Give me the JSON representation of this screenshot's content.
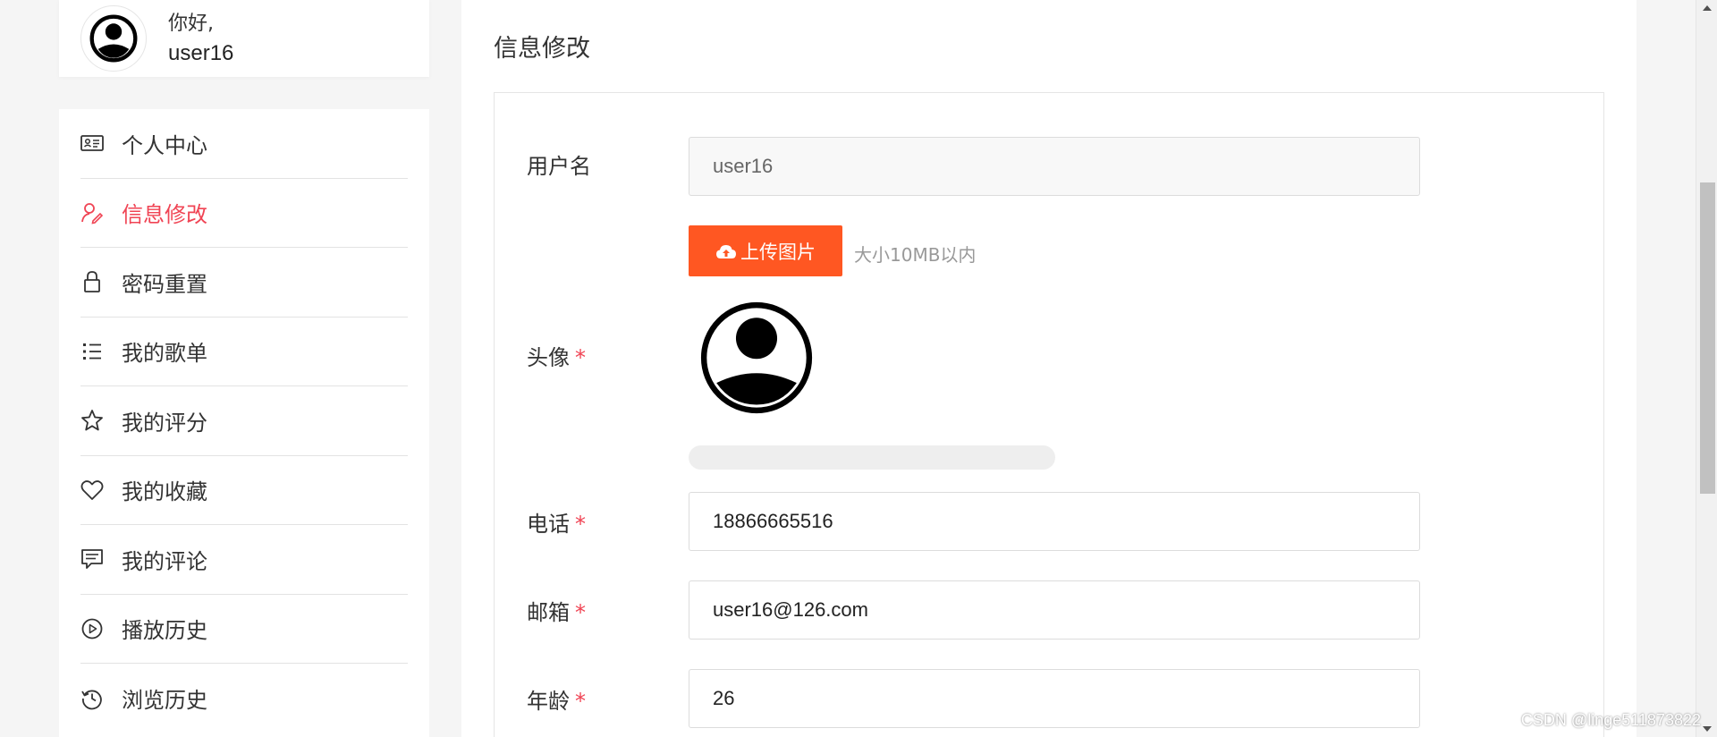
{
  "user": {
    "greeting": "你好,",
    "name": "user16"
  },
  "sidebar": {
    "items": [
      {
        "label": "个人中心",
        "icon": "id-card-icon",
        "active": false
      },
      {
        "label": "信息修改",
        "icon": "user-edit-icon",
        "active": true
      },
      {
        "label": "密码重置",
        "icon": "lock-icon",
        "active": false
      },
      {
        "label": "我的歌单",
        "icon": "list-icon",
        "active": false
      },
      {
        "label": "我的评分",
        "icon": "star-icon",
        "active": false
      },
      {
        "label": "我的收藏",
        "icon": "heart-icon",
        "active": false
      },
      {
        "label": "我的评论",
        "icon": "comment-icon",
        "active": false
      },
      {
        "label": "播放历史",
        "icon": "play-circle-icon",
        "active": false
      },
      {
        "label": "浏览历史",
        "icon": "history-icon",
        "active": false
      }
    ]
  },
  "main": {
    "title": "信息修改",
    "form": {
      "username": {
        "label": "用户名",
        "value": "user16"
      },
      "avatar": {
        "label": "头像",
        "required_mark": "*",
        "upload_label": "上传图片",
        "upload_tip": "大小10MB以内",
        "progress_percent": 0
      },
      "phone": {
        "label": "电话",
        "required_mark": "*",
        "value": "18866665516"
      },
      "email": {
        "label": "邮箱",
        "required_mark": "*",
        "value": "user16@126.com"
      },
      "age": {
        "label": "年龄",
        "required_mark": "*",
        "value": "26"
      }
    }
  },
  "watermark": "CSDN @linge511873822",
  "colors": {
    "accent": "#f04454",
    "upload": "#ff5722"
  }
}
